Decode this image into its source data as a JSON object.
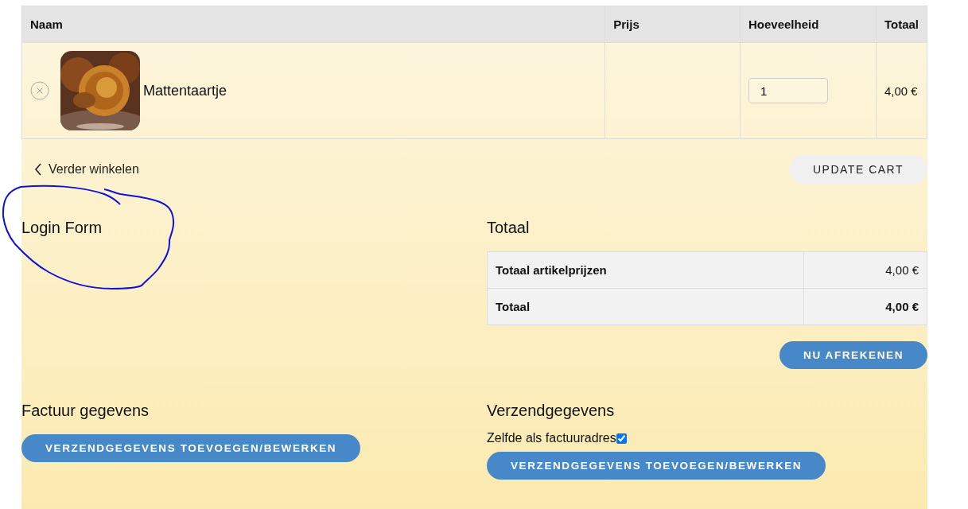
{
  "cart": {
    "columns": [
      "Naam",
      "Prijs",
      "Hoeveelheid",
      "Totaal"
    ],
    "rows": [
      {
        "name": "Mattentaartje",
        "price": "",
        "quantity": "1",
        "total": "4,00 €"
      }
    ]
  },
  "continue_link": "Verder winkelen",
  "update_button": "UPDATE CART",
  "login": {
    "title": "Login Form",
    "annotated": true
  },
  "totals": {
    "title": "Totaal",
    "rows": [
      {
        "label": "Totaal artikelprijzen",
        "value": "4,00 €",
        "bold": false
      },
      {
        "label": "Totaal",
        "value": "4,00 €",
        "bold": true
      }
    ],
    "checkout_button": "NU AFREKENEN"
  },
  "billing": {
    "title": "Factuur gegevens",
    "button": "VERZENDGEGEVENS TOEVOEGEN/BEWERKEN"
  },
  "shipping": {
    "title": "Verzendgegevens",
    "same_as_billing": {
      "label": "Zelfde als factuuradres",
      "checked": true
    },
    "button": "VERZENDGEGEVENS TOEVOEGEN/BEWERKEN"
  }
}
